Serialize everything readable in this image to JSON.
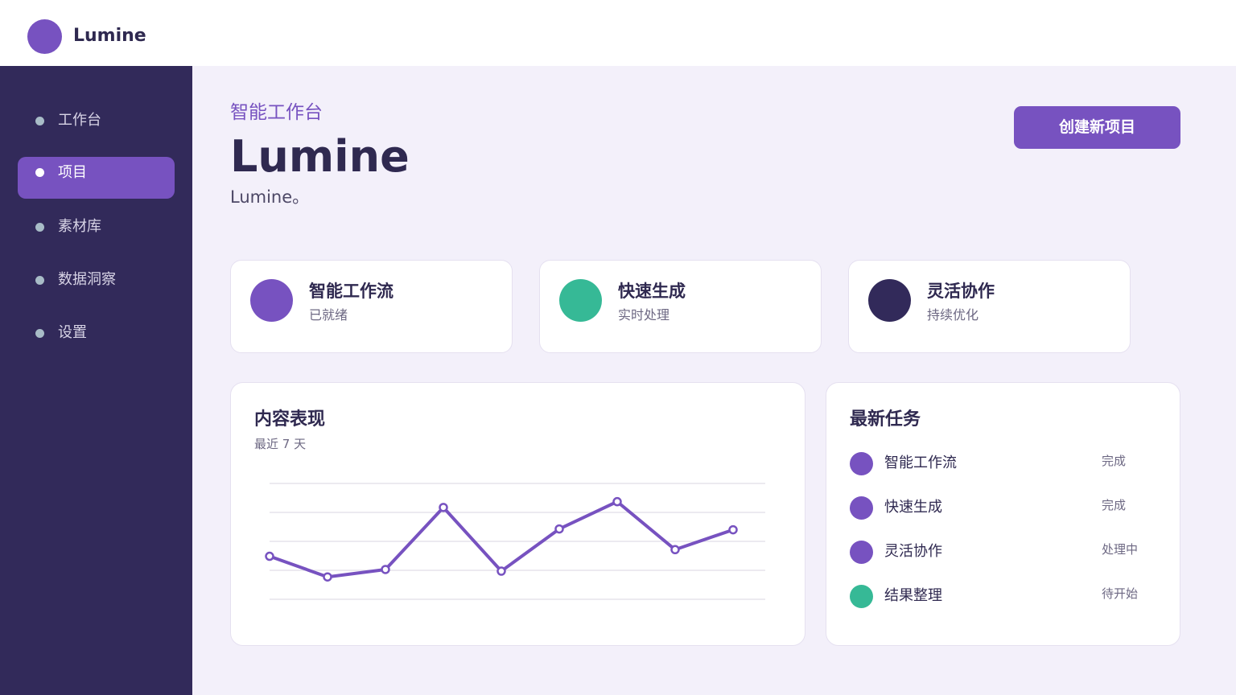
{
  "app": {
    "name": "Lumine"
  },
  "sidebar": {
    "items": [
      {
        "label": "工作台",
        "active": false
      },
      {
        "label": "项目",
        "active": true
      },
      {
        "label": "素材库",
        "active": false
      },
      {
        "label": "数据洞察",
        "active": false
      },
      {
        "label": "设置",
        "active": false
      }
    ]
  },
  "hero": {
    "eyebrow": "智能工作台",
    "title": "Lumine",
    "subtitle": "Lumine。",
    "create_button": "创建新项目"
  },
  "features": [
    {
      "title": "智能工作流",
      "subtitle": "已就绪",
      "color": "#7752c0"
    },
    {
      "title": "快速生成",
      "subtitle": "实时处理",
      "color": "#36b996"
    },
    {
      "title": "灵活协作",
      "subtitle": "持续优化",
      "color": "#322a5a"
    }
  ],
  "performance": {
    "title": "内容表现",
    "subtitle": "最近 7 天"
  },
  "chart_data": {
    "type": "line",
    "series": [
      {
        "values": [
          52,
          27,
          36,
          111,
          34,
          85,
          118,
          60,
          84
        ]
      }
    ],
    "ylim": [
      0,
      140
    ],
    "grid": true,
    "color": "#7752c0"
  },
  "tasks": {
    "title": "最新任务",
    "items": [
      {
        "name": "智能工作流",
        "status": "完成",
        "color": "#7752c0"
      },
      {
        "name": "快速生成",
        "status": "完成",
        "color": "#7752c0"
      },
      {
        "name": "灵活协作",
        "status": "处理中",
        "color": "#7752c0"
      },
      {
        "name": "结果整理",
        "status": "待开始",
        "color": "#36b996"
      }
    ]
  },
  "colors": {
    "accent": "#7752c0",
    "sidebar": "#322a5a",
    "success": "#36b996",
    "background": "#f3f0fa"
  }
}
